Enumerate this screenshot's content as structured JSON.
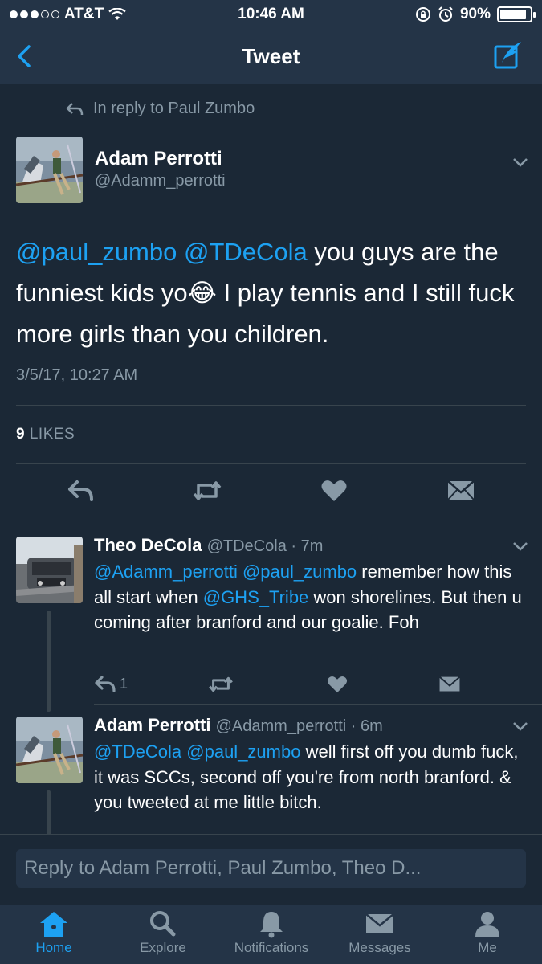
{
  "status_bar": {
    "carrier": "AT&T",
    "time": "10:46 AM",
    "battery": "90%",
    "battery_level": 0.9
  },
  "nav": {
    "title": "Tweet"
  },
  "main_tweet": {
    "reply_context": "In reply to Paul Zumbo",
    "author_name": "Adam Perrotti",
    "author_handle": "@Adamm_perrotti",
    "text_parts": {
      "mention1": "@paul_zumbo",
      "mention2": "@TDeCola",
      "text": " you guys are the funniest kids yo😂 I play tennis and I still fuck more girls than you children."
    },
    "timestamp": "3/5/17, 10:27 AM",
    "likes_count": "9",
    "likes_label": "LIKES"
  },
  "replies": [
    {
      "name": "Theo DeCola",
      "meta": "@TDeCola · 7m",
      "mention1": "@Adamm_perrotti",
      "mention2": "@paul_zumbo",
      "text1": " remember how this all start when ",
      "mention3": "@GHS_Tribe",
      "text2": " won shorelines. But then u coming after branford and our goalie. Foh",
      "reply_count": "1"
    },
    {
      "name": "Adam Perrotti",
      "meta": "@Adamm_perrotti · 6m",
      "mention1": "@TDeCola",
      "mention2": "@paul_zumbo",
      "text1": " well first off you dumb fuck, it was SCCs, second off you're from north branford. & you tweeted at me little bitch."
    }
  ],
  "reply_bar": {
    "placeholder": "Reply to Adam Perrotti, Paul Zumbo, Theo D..."
  },
  "tabs": [
    {
      "label": "Home",
      "icon": "home-icon",
      "active": true
    },
    {
      "label": "Explore",
      "icon": "search-icon"
    },
    {
      "label": "Notifications",
      "icon": "bell-icon"
    },
    {
      "label": "Messages",
      "icon": "envelope-icon"
    },
    {
      "label": "Me",
      "icon": "person-icon"
    }
  ],
  "colors": {
    "background": "#1b2836",
    "bar": "#243447",
    "accent": "#1da1f2",
    "muted": "#8899a6"
  }
}
